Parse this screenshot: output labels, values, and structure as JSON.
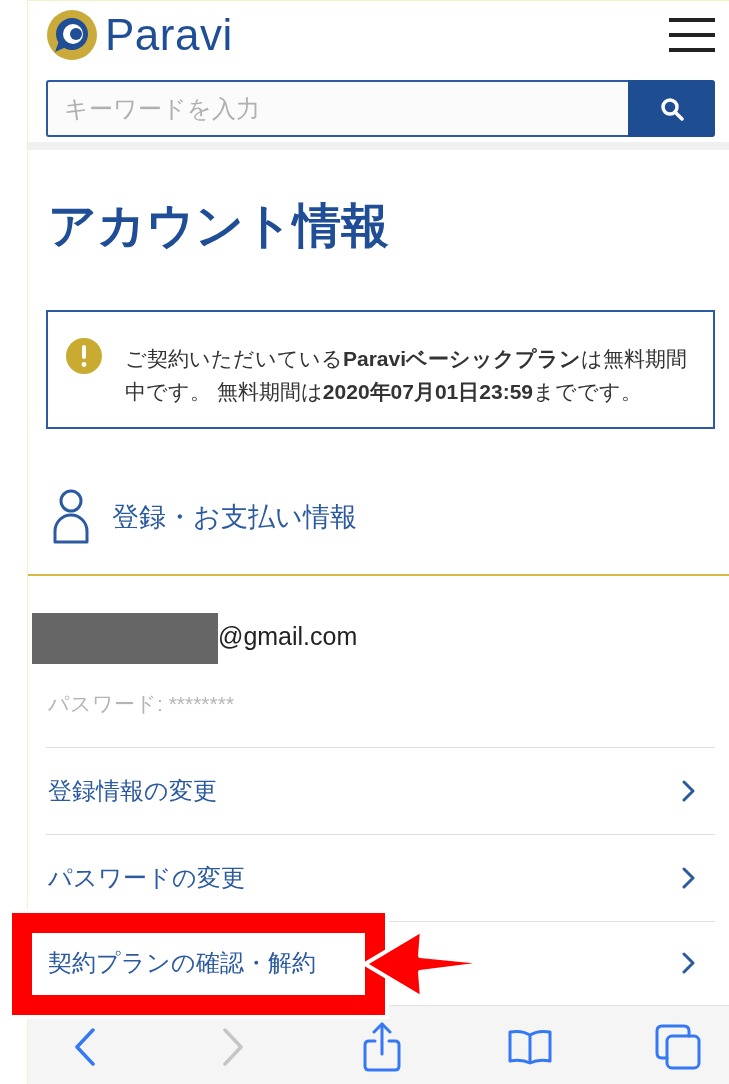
{
  "header": {
    "logo_text": "Paravi",
    "search": {
      "placeholder": "キーワードを入力"
    }
  },
  "page_title": "アカウント情報",
  "notice": {
    "text": "ご契約いただいている**Paraviベーシックプラン**は無料期間中です。 無料期間は**2020年07月01日23:59**までです。"
  },
  "account_section": {
    "title": "登録・お支払い情報",
    "email_redacted": true,
    "email": "@gmail.com",
    "password": "パスワード: ********"
  },
  "menu_items": [
    {
      "label": "登録情報の変更",
      "highlighted": false
    },
    {
      "label": "パスワードの変更",
      "highlighted": false
    },
    {
      "label": "契約プランの確認・解約",
      "highlighted": true
    }
  ],
  "toolbar": {
    "buttons": [
      {
        "kind": "back",
        "disabled": false
      },
      {
        "kind": "forward",
        "disabled": true
      },
      {
        "kind": "share",
        "disabled": false
      },
      {
        "kind": "bookmarks",
        "disabled": false
      },
      {
        "kind": "tabs",
        "disabled": false
      }
    ]
  }
}
